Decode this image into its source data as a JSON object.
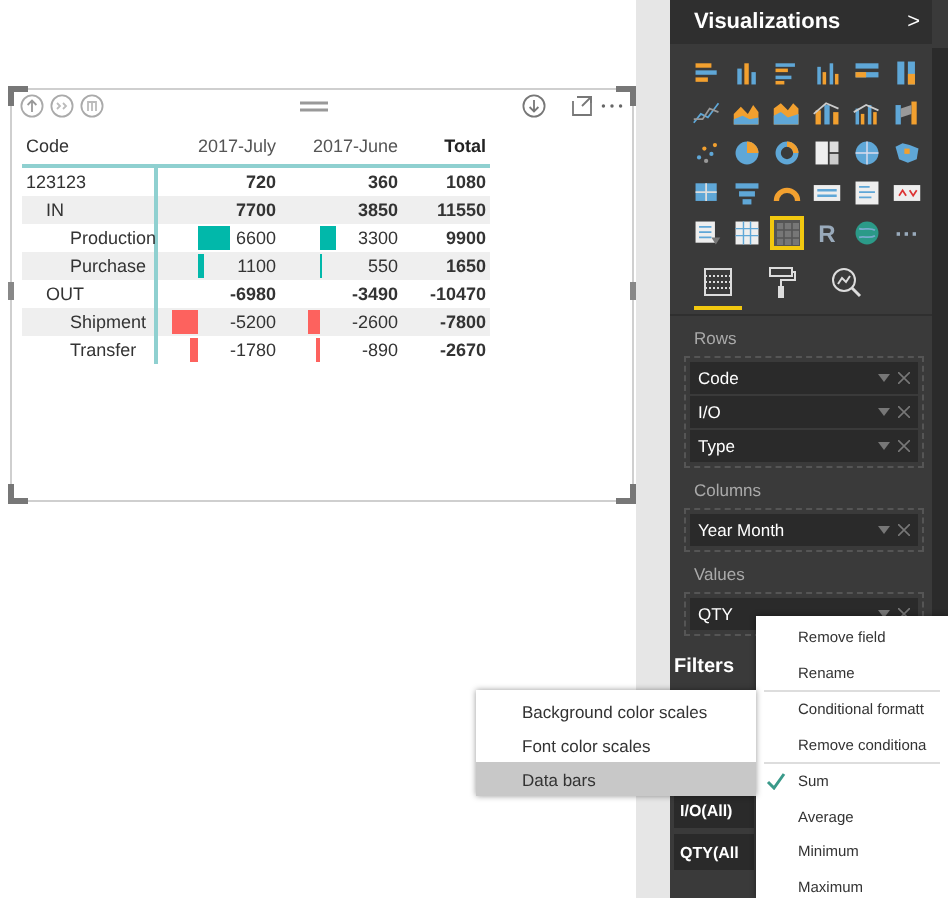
{
  "matrix": {
    "columns": [
      "Code",
      "2017-July",
      "2017-June",
      "Total"
    ],
    "rows": [
      {
        "kind": "top",
        "shaded": false,
        "cells": [
          {
            "value": "123123"
          },
          {
            "value": "720"
          },
          {
            "value": "360"
          },
          {
            "value": "1080"
          }
        ]
      },
      {
        "kind": "group",
        "shaded": true,
        "cells": [
          {
            "value": "IN"
          },
          {
            "value": "7700"
          },
          {
            "value": "3850"
          },
          {
            "value": "11550"
          }
        ]
      },
      {
        "kind": "leaf",
        "shaded": false,
        "cells": [
          {
            "value": "Production"
          },
          {
            "value": "6600",
            "bar": {
              "kind": "positive"
            }
          },
          {
            "value": "3300",
            "bar": {
              "kind": "positive"
            }
          },
          {
            "value": "9900"
          }
        ]
      },
      {
        "kind": "leaf",
        "shaded": true,
        "cells": [
          {
            "value": "Purchase"
          },
          {
            "value": "1100",
            "bar": {
              "kind": "positive"
            }
          },
          {
            "value": "550",
            "bar": {
              "kind": "positive"
            }
          },
          {
            "value": "1650"
          }
        ]
      },
      {
        "kind": "group",
        "shaded": false,
        "cells": [
          {
            "value": "OUT"
          },
          {
            "value": "-6980"
          },
          {
            "value": "-3490"
          },
          {
            "value": "-10470"
          }
        ]
      },
      {
        "kind": "leaf",
        "shaded": true,
        "cells": [
          {
            "value": "Shipment"
          },
          {
            "value": "-5200",
            "bar": {
              "kind": "negative"
            }
          },
          {
            "value": "-2600",
            "bar": {
              "kind": "negative"
            }
          },
          {
            "value": "-7800"
          }
        ]
      },
      {
        "kind": "leaf",
        "shaded": false,
        "cells": [
          {
            "value": "Transfer"
          },
          {
            "value": "-1780",
            "bar": {
              "kind": "negative"
            }
          },
          {
            "value": "-890",
            "bar": {
              "kind": "negative"
            }
          },
          {
            "value": "-2670"
          }
        ]
      }
    ]
  },
  "pane": {
    "title": "Visualizations",
    "collapse": ">",
    "visuals": [
      {
        "kind": "stacked-bar",
        "selected": false
      },
      {
        "kind": "stacked-column",
        "selected": false
      },
      {
        "kind": "clustered-bar",
        "selected": false
      },
      {
        "kind": "clustered-column",
        "selected": false
      },
      {
        "kind": "bar100",
        "selected": false
      },
      {
        "kind": "column100",
        "selected": false
      },
      {
        "kind": "line",
        "selected": false
      },
      {
        "kind": "area",
        "selected": false
      },
      {
        "kind": "stacked-area",
        "selected": false
      },
      {
        "kind": "line-column",
        "selected": false
      },
      {
        "kind": "line-column2",
        "selected": false
      },
      {
        "kind": "ribbon",
        "selected": false
      },
      {
        "kind": "scatter",
        "selected": false
      },
      {
        "kind": "pie",
        "selected": false
      },
      {
        "kind": "donut",
        "selected": false
      },
      {
        "kind": "treemap",
        "selected": false
      },
      {
        "kind": "map",
        "selected": false
      },
      {
        "kind": "filled-map",
        "selected": false
      },
      {
        "kind": "shape-map",
        "selected": false
      },
      {
        "kind": "funnel",
        "selected": false
      },
      {
        "kind": "gauge",
        "selected": false
      },
      {
        "kind": "card",
        "selected": false
      },
      {
        "kind": "multirow-card",
        "selected": false
      },
      {
        "kind": "kpi",
        "selected": false
      },
      {
        "kind": "slicer",
        "selected": false
      },
      {
        "kind": "table",
        "selected": false
      },
      {
        "kind": "matrix",
        "selected": true
      },
      {
        "kind": "text",
        "text": "R",
        "selected": false
      },
      {
        "kind": "globe",
        "selected": false
      },
      {
        "kind": "text",
        "text": "···",
        "selected": false
      }
    ],
    "tabs": [
      {
        "kind": "fields",
        "selected": true
      },
      {
        "kind": "format",
        "selected": false
      },
      {
        "kind": "analytics",
        "selected": false
      }
    ],
    "sections": [
      {
        "title": "Rows",
        "wells": [
          "Code",
          "I/O",
          "Type"
        ]
      },
      {
        "title": "Columns",
        "wells": [
          "Year Month"
        ]
      },
      {
        "title": "Values",
        "wells": [
          "QTY"
        ]
      }
    ],
    "filters_title": "Filters",
    "filters": [
      "I/O(All)",
      "QTY(All"
    ]
  },
  "field_menu": {
    "items": [
      {
        "kind": "item",
        "label": "Remove field",
        "checked": false
      },
      {
        "kind": "item",
        "label": "Rename",
        "checked": false
      },
      {
        "kind": "separator"
      },
      {
        "kind": "item",
        "label": "Conditional formatt",
        "checked": false
      },
      {
        "kind": "item",
        "label": "Remove conditiona",
        "checked": false
      },
      {
        "kind": "separator"
      },
      {
        "kind": "item",
        "label": "Sum",
        "checked": true
      },
      {
        "kind": "item",
        "label": "Average",
        "checked": false
      },
      {
        "kind": "item",
        "label": "Minimum",
        "checked": false
      },
      {
        "kind": "item",
        "label": "Maximum",
        "checked": false
      }
    ]
  },
  "submenu": {
    "items": [
      {
        "label": "Background color scales",
        "selected": false
      },
      {
        "label": "Font color scales",
        "selected": false
      },
      {
        "label": "Data bars",
        "selected": true
      }
    ]
  }
}
